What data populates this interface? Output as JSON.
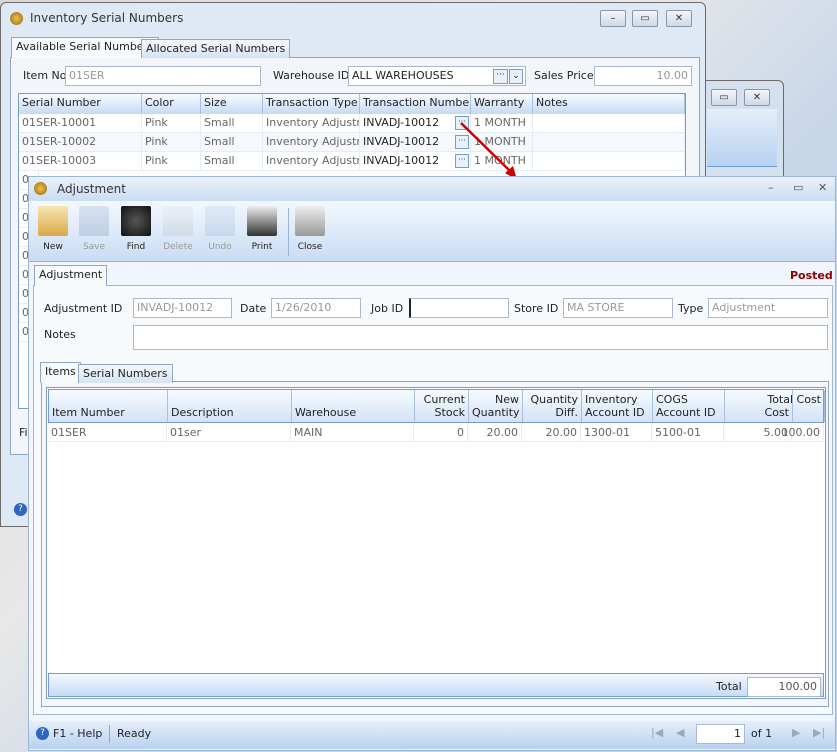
{
  "serial_window": {
    "title": "Inventory Serial Numbers",
    "tabs": [
      "Available Serial Numbers",
      "Allocated Serial Numbers"
    ],
    "item_no_label": "Item No",
    "item_no": "01SER",
    "warehouse_label": "Warehouse ID",
    "warehouse": "ALL WAREHOUSES",
    "sales_price_label": "Sales Price",
    "sales_price": "10.00",
    "columns": [
      "Serial Number",
      "Color",
      "Size",
      "Transaction Type",
      "Transaction Number",
      "Warranty",
      "Notes"
    ],
    "rows": [
      [
        "01SER-10001",
        "Pink",
        "Small",
        "Inventory Adjustment",
        "INVADJ-10012",
        "1 MONTH",
        ""
      ],
      [
        "01SER-10002",
        "Pink",
        "Small",
        "Inventory Adjustment",
        "INVADJ-10012",
        "1 MONTH",
        ""
      ],
      [
        "01SER-10003",
        "Pink",
        "Small",
        "Inventory Adjustment",
        "INVADJ-10012",
        "1 MONTH",
        ""
      ]
    ],
    "hidden_row_stub": "0",
    "footer_stub": "Fi"
  },
  "adjustment_window": {
    "title": "Adjustment",
    "toolbar": [
      {
        "label": "New",
        "icon": "new-icon",
        "enabled": true
      },
      {
        "label": "Save",
        "icon": "save-icon",
        "enabled": false
      },
      {
        "label": "Find",
        "icon": "binoculars-icon",
        "enabled": true
      },
      {
        "label": "Delete",
        "icon": "trash-icon",
        "enabled": false
      },
      {
        "label": "Undo",
        "icon": "undo-icon",
        "enabled": false
      },
      {
        "label": "Print",
        "icon": "printer-icon",
        "enabled": true
      },
      {
        "label": "Close",
        "icon": "close-form-icon",
        "enabled": true
      }
    ],
    "tab": "Adjustment",
    "status": "Posted",
    "status_color": "#8b0000",
    "fields": {
      "adjustment_id_label": "Adjustment ID",
      "adjustment_id": "INVADJ-10012",
      "date_label": "Date",
      "date": "1/26/2010",
      "job_id_label": "Job ID",
      "job_id": "",
      "store_id_label": "Store ID",
      "store_id": "MA STORE",
      "type_label": "Type",
      "type": "Adjustment",
      "notes_label": "Notes",
      "notes": ""
    },
    "sub_tabs": [
      "Items",
      "Serial Numbers"
    ],
    "columns": [
      [
        "",
        "Item Number"
      ],
      [
        "",
        "Description"
      ],
      [
        "",
        "Warehouse"
      ],
      [
        "Current",
        "Stock"
      ],
      [
        "New",
        "Quantity"
      ],
      [
        "Quantity",
        "Diff."
      ],
      [
        "Inventory",
        "Account ID"
      ],
      [
        "COGS",
        "Account ID"
      ],
      [
        "",
        "Cost"
      ],
      [
        "Total Cost",
        ""
      ]
    ],
    "rows": [
      [
        "01SER",
        "01ser",
        "MAIN",
        "0",
        "20.00",
        "20.00",
        "1300-01",
        "5100-01",
        "5.00",
        "100.00"
      ]
    ],
    "total_label": "Total",
    "total": "100.00",
    "statusbar": {
      "help": "F1 - Help",
      "state": "Ready",
      "page": "1",
      "of": "of 1"
    }
  }
}
